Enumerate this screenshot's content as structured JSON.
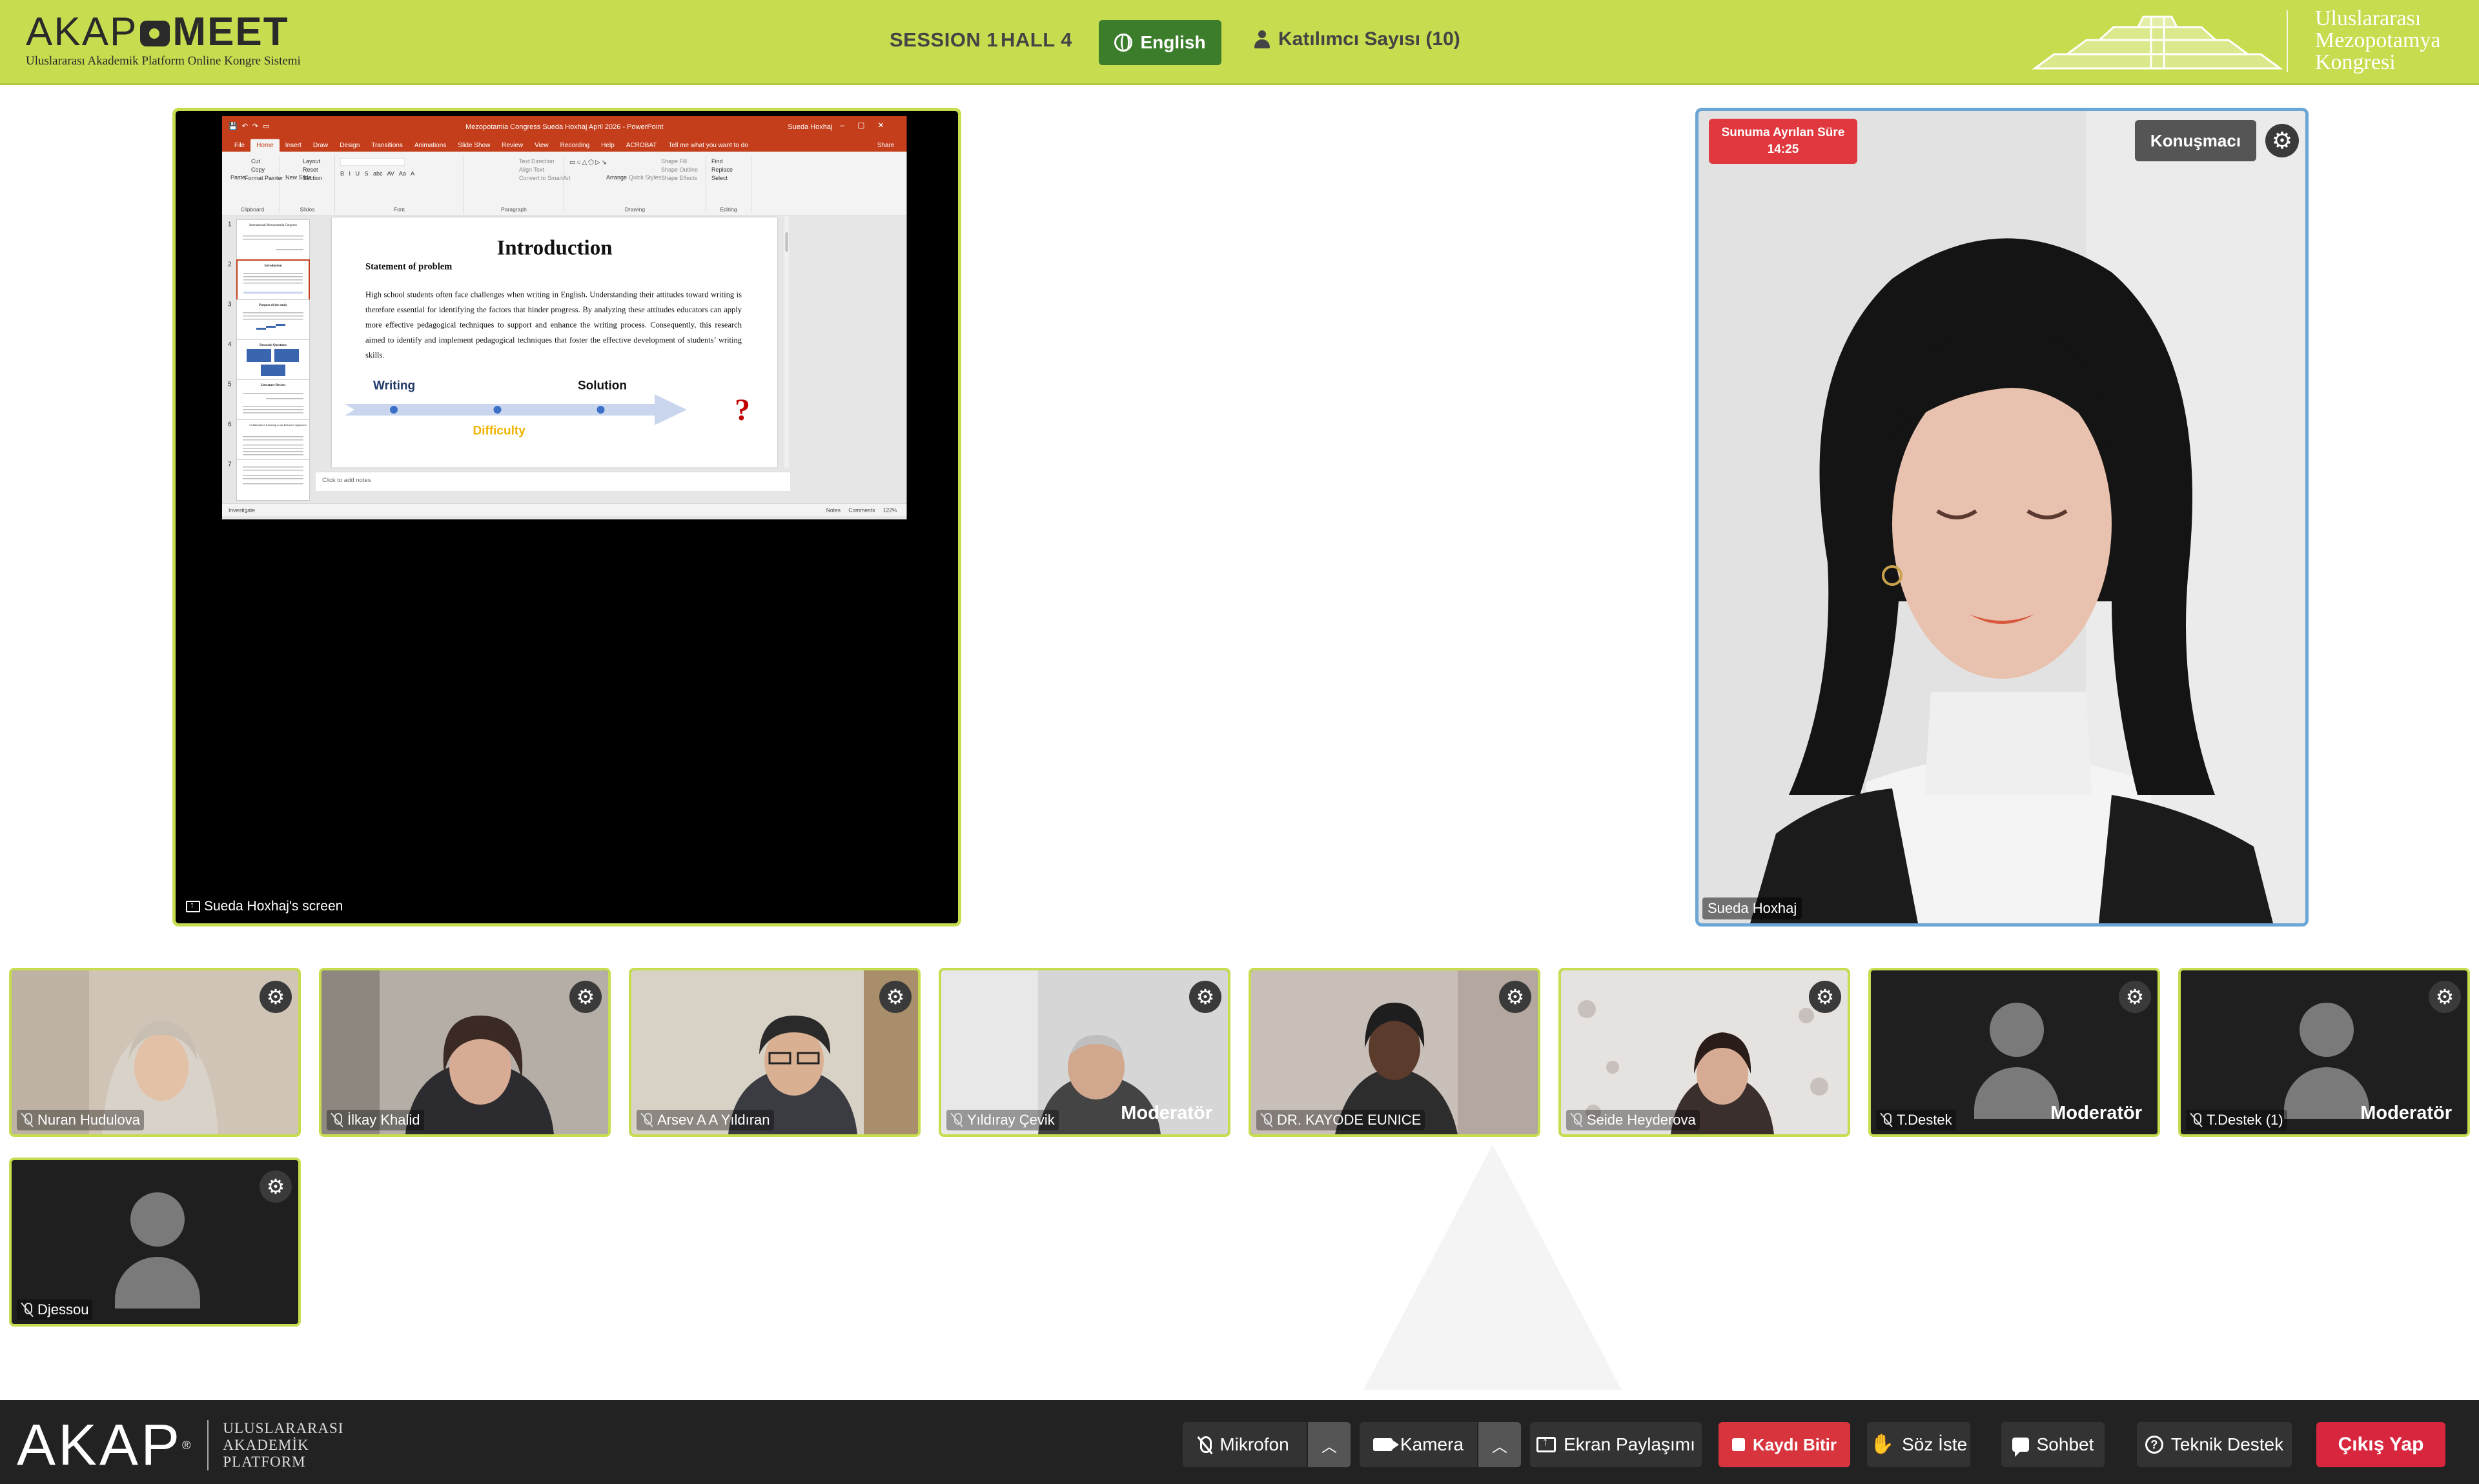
{
  "header": {
    "logo_text_prefix": "AKAP",
    "logo_text_suffix": "MEET",
    "logo_subtitle": "Uluslararası Akademik Platform Online Kongre Sistemi",
    "session": "SESSION 1",
    "hall": "HALL 4",
    "language_button": "English",
    "participant_count": "Katılımcı Sayısı (10)",
    "congress_name": [
      "Uluslararası",
      "Mezopotamya",
      "Kongresi"
    ]
  },
  "shared_screen": {
    "owner_label": "Sueda Hoxhaj's screen",
    "powerpoint": {
      "window_title": "Mezopotamia Congress  Sueda Hoxhaj April 2026  -  PowerPoint",
      "user_name": "Sueda Hoxhaj",
      "tabs": [
        "File",
        "Home",
        "Insert",
        "Draw",
        "Design",
        "Transitions",
        "Animations",
        "Slide Show",
        "Review",
        "View",
        "Recording",
        "Help",
        "ACROBAT",
        "Tell me what you want to do"
      ],
      "share_tab": "Share",
      "ribbon_groups": [
        {
          "label": "Clipboard",
          "items": [
            "Paste",
            "Cut",
            "Copy",
            "Format Painter"
          ]
        },
        {
          "label": "Slides",
          "items": [
            "New Slide",
            "Layout",
            "Reset",
            "Section"
          ]
        },
        {
          "label": "Font",
          "items": [
            "B",
            "I",
            "U",
            "S",
            "abc",
            "AV",
            "Aa",
            "A"
          ]
        },
        {
          "label": "Paragraph",
          "items": [
            "Text Direction",
            "Align Text",
            "Convert to SmartArt"
          ]
        },
        {
          "label": "Drawing",
          "items": [
            "Arrange",
            "Quick Styles",
            "Shape Fill",
            "Shape Outline",
            "Shape Effects"
          ]
        },
        {
          "label": "Editing",
          "items": [
            "Find",
            "Replace",
            "Select"
          ]
        }
      ],
      "thumbnails": [
        {
          "num": "1",
          "title": "International Mesopotamia Congress"
        },
        {
          "num": "2",
          "title": "Introduction"
        },
        {
          "num": "3",
          "title": "Purpose of the study"
        },
        {
          "num": "4",
          "title": "Research Questions"
        },
        {
          "num": "5",
          "title": "Literature Review"
        },
        {
          "num": "6",
          "title": "Collaborative Learning as an Inclusive Approach"
        },
        {
          "num": "7",
          "title": ""
        }
      ],
      "slide": {
        "title": "Introduction",
        "subtitle": "Statement of problem",
        "paragraph": "High school students often face challenges when writing in English. Understanding their attitudes toward writing is therefore essential for identifying the factors that hinder progress. By analyzing these attitudes educators can apply more effective pedagogical techniques to support and enhance the writing process. Consequently, this research aimed to identify and implement pedagogical techniques that foster the effective development of students’ writing skills.",
        "label_writing": "Writing",
        "label_solution": "Solution",
        "label_difficulty": "Difficulty",
        "question_mark": "?"
      },
      "notes_placeholder": "Click to add notes",
      "status_left": "Investigate",
      "status_right": "Notes  Comments  122%"
    }
  },
  "speaker": {
    "timer_label": "Sunuma Ayrılan Süre",
    "timer_value": "14:25",
    "role_button": "Konuşmacı",
    "name": "Sueda Hoxhaj"
  },
  "participants": [
    {
      "name": "Nuran Hudulova",
      "role": ""
    },
    {
      "name": "İlkay Khalid",
      "role": ""
    },
    {
      "name": "Arsev A A Yıldıran",
      "role": ""
    },
    {
      "name": "Yıldıray Çevik",
      "role": "Moderatör"
    },
    {
      "name": "DR. KAYODE EUNICE",
      "role": ""
    },
    {
      "name": "Seide Heyderova",
      "role": ""
    },
    {
      "name": "T.Destek",
      "role": "Moderatör"
    },
    {
      "name": "T.Destek (1)",
      "role": "Moderatör"
    },
    {
      "name": "Djessou",
      "role": ""
    }
  ],
  "toolbar": {
    "brand": "AKAP",
    "brand_sub": [
      "ULUSLARARASI",
      "AKADEMİK",
      "PLATFORM"
    ],
    "mic": "Mikrofon",
    "camera": "Kamera",
    "screen_share": "Ekran Paylaşımı",
    "record": "Kaydı Bitir",
    "raise_hand": "Söz İste",
    "chat": "Sohbet",
    "support": "Teknik Destek",
    "exit": "Çıkış Yap"
  },
  "colors": {
    "accent": "#c8dc4f",
    "button_green": "#3b7d2a",
    "recording_red": "#d7343e",
    "toolbar_bg": "#222222",
    "powerpoint_red": "#c43e1c"
  }
}
